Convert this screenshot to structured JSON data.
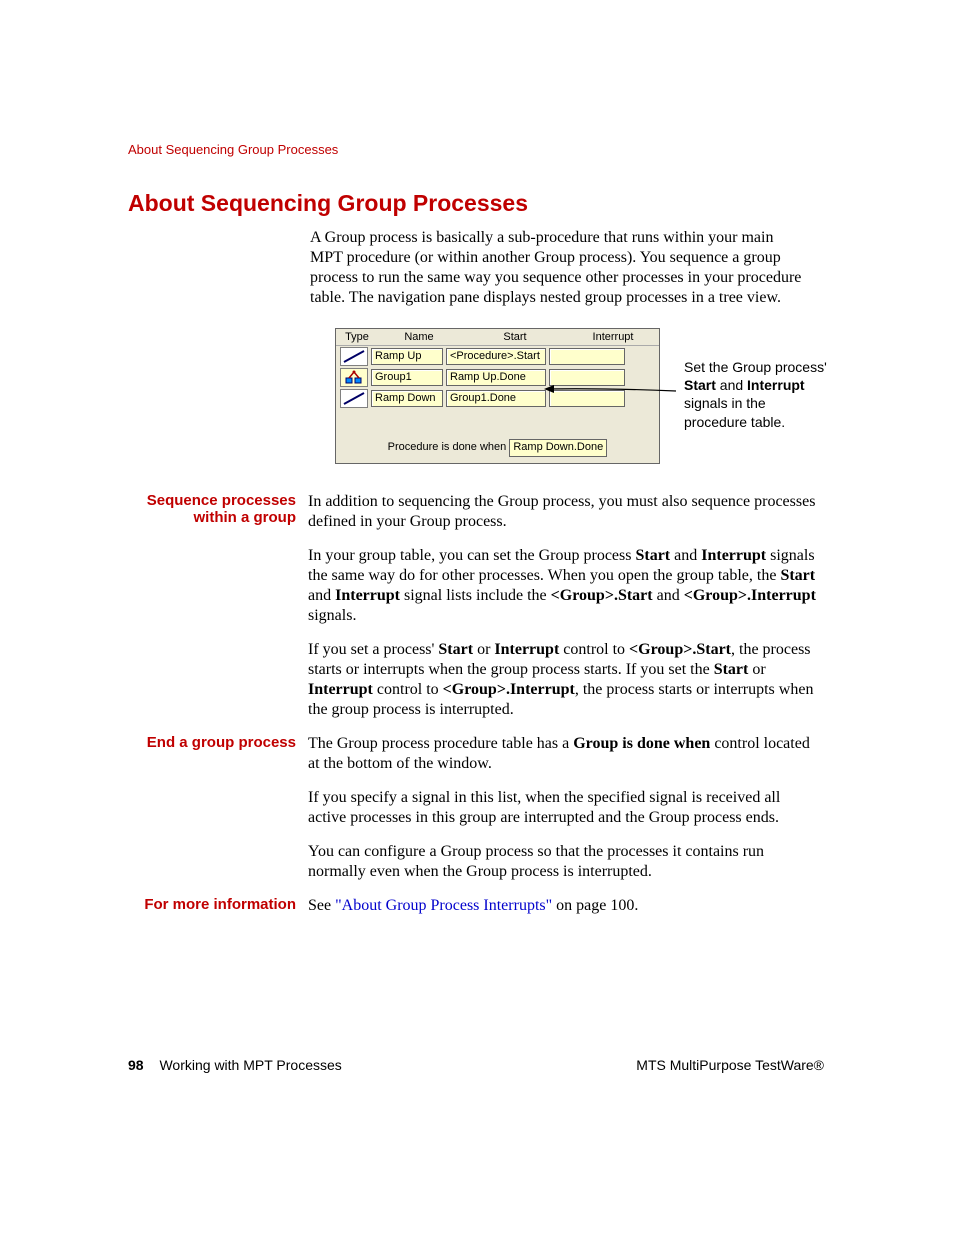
{
  "runningHeader": "About Sequencing Group Processes",
  "title": "About Sequencing Group Processes",
  "intro": "A Group process is basically a sub-procedure that runs within your main MPT procedure (or within another Group process). You sequence a group process to run the same way you sequence other processes in your procedure table. The navigation pane displays nested group processes in a tree view.",
  "figure": {
    "headers": {
      "type": "Type",
      "name": "Name",
      "start": "Start",
      "interrupt": "Interrupt"
    },
    "rows": [
      {
        "iconKind": "ramp",
        "name": "Ramp Up",
        "start": "<Procedure>.Start",
        "interrupt": ""
      },
      {
        "iconKind": "group",
        "name": "Group1",
        "start": "Ramp Up.Done",
        "interrupt": ""
      },
      {
        "iconKind": "ramp",
        "name": "Ramp Down",
        "start": "Group1.Done",
        "interrupt": ""
      }
    ],
    "doneLabel": "Procedure is done when",
    "doneValue": "Ramp Down.Done"
  },
  "callout": {
    "t1": "Set the Group process' ",
    "b1": "Start",
    "t2": " and ",
    "b2": "Interrupt",
    "t3": " signals in the procedure table."
  },
  "sections": {
    "seq": {
      "label": "Sequence processes within a group",
      "p1": "In addition to sequencing the Group process, you must also sequence processes defined in your Group process.",
      "p2a": "In your group table, you can set the Group process ",
      "p2b": "Start",
      "p2c": " and ",
      "p2d": "Interrupt",
      "p2e": " signals the same way do for other processes. When you open the group table, the ",
      "p2f": "Start",
      "p2g": " and ",
      "p2h": "Interrupt",
      "p2i": " signal lists include the ",
      "p2j": "<Group>.Start",
      "p2k": " and ",
      "p2l": "<Group>.Interrupt",
      "p2m": " signals.",
      "p3a": "If you set a process' ",
      "p3b": "Start",
      "p3c": " or ",
      "p3d": "Interrupt",
      "p3e": " control to ",
      "p3f": "<Group>.Start",
      "p3g": ", the process starts or interrupts when the group process starts. If you set the ",
      "p3h": "Start",
      "p3i": " or ",
      "p3j": "Interrupt",
      "p3k": " control to ",
      "p3l": "<Group>.Interrupt",
      "p3m": ", the process starts or interrupts when the group process is interrupted."
    },
    "end": {
      "label": "End a group process",
      "p1a": "The Group process procedure table has a ",
      "p1b": "Group is done when",
      "p1c": " control located at the bottom of the window.",
      "p2": "If you specify a signal in this list, when the specified signal is received all active processes in this group are interrupted and the Group process ends.",
      "p3": "You can configure a Group process so that the processes it contains run normally even when the Group process is interrupted."
    },
    "more": {
      "label": "For more information",
      "pre": "See ",
      "link": "\"About Group Process Interrupts\"",
      "post": " on page 100."
    }
  },
  "footer": {
    "pageNum": "98",
    "chapter": "Working with MPT Processes",
    "product": "MTS MultiPurpose TestWare®"
  }
}
